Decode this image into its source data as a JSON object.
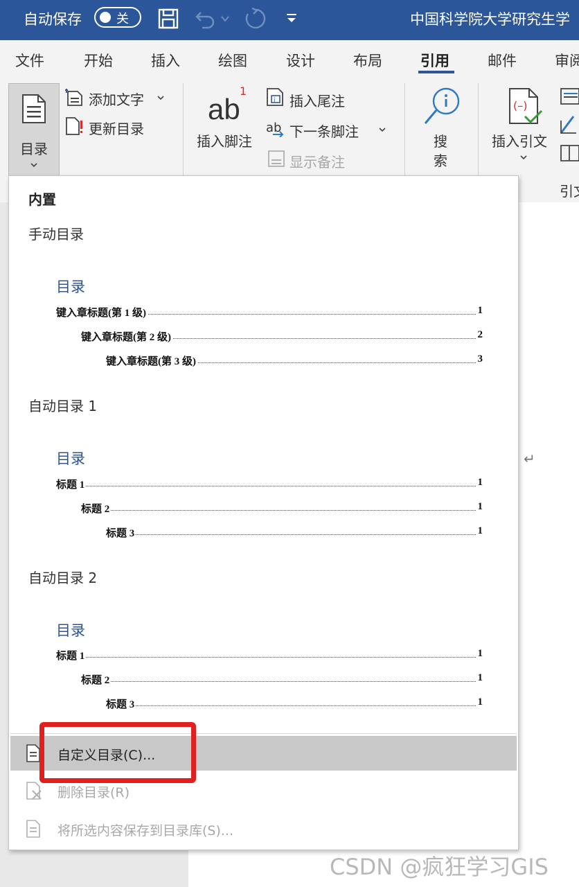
{
  "title_bar": {
    "autosave_label": "自动保存",
    "autosave_state": "关",
    "document_title": "中国科学院大学研究生学"
  },
  "tabs": [
    "文件",
    "开始",
    "插入",
    "绘图",
    "设计",
    "布局",
    "引用",
    "邮件",
    "审阅"
  ],
  "active_tab": "引用",
  "ribbon": {
    "toc_button": "目录",
    "add_text": "添加文字",
    "update_toc": "更新目录",
    "insert_footnote": "插入脚注",
    "footnote_glyph": "ab",
    "footnote_superscript": "1",
    "insert_endnote": "插入尾注",
    "next_footnote": "下一条脚注",
    "show_notes": "显示备注",
    "search_line1": "搜",
    "search_line2": "索",
    "insert_citation": "插入引文",
    "citation_group_partial": "引文"
  },
  "menu": {
    "section_header": "内置",
    "sections": [
      {
        "title": "手动目录",
        "toc_heading": "目录",
        "entries": [
          {
            "label": "键入章标题(第 1 级)",
            "page": "1"
          },
          {
            "label": "键入章标题(第 2 级)",
            "page": "2"
          },
          {
            "label": "键入章标题(第 3 级)",
            "page": "3"
          }
        ]
      },
      {
        "title": "自动目录 1",
        "toc_heading": "目录",
        "entries": [
          {
            "label": "标题 1",
            "page": "1"
          },
          {
            "label": "标题 2",
            "page": "1"
          },
          {
            "label": "标题 3",
            "page": "1"
          }
        ]
      },
      {
        "title": "自动目录 2",
        "toc_heading": "目录",
        "entries": [
          {
            "label": "标题 1",
            "page": "1"
          },
          {
            "label": "标题 2",
            "page": "1"
          },
          {
            "label": "标题 3",
            "page": "1"
          }
        ]
      }
    ],
    "actions": [
      {
        "label": "自定义目录(C)...",
        "enabled": true,
        "highlighted": true
      },
      {
        "label": "删除目录(R)",
        "enabled": false
      },
      {
        "label": "将所选内容保存到目录库(S)...",
        "enabled": false
      }
    ]
  },
  "paragraph_mark": "↵",
  "watermark": "CSDN @疯狂学习GIS",
  "colors": {
    "title_bar": "#2b579a",
    "ribbon_bg": "#f3f3f3",
    "toc_heading": "#2f5496",
    "highlight_row": "#c8c8c8",
    "annotation_red": "#e02020"
  }
}
